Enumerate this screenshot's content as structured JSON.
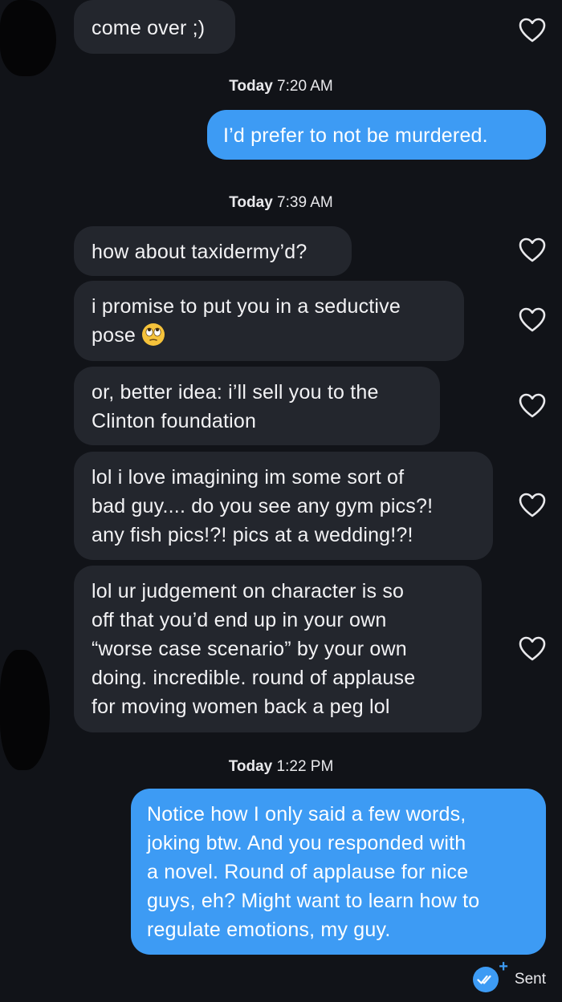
{
  "messages": [
    {
      "text": "come over ;)"
    },
    {
      "time_day": "Today",
      "time": "7:20 AM"
    },
    {
      "text": "I’d prefer to not be murdered."
    },
    {
      "time_day": "Today",
      "time": "7:39 AM"
    },
    {
      "text": "how about taxidermy’d?"
    },
    {
      "text_line1": "i promise to put you in a seductive",
      "text_line2": "pose"
    },
    {
      "text_line1": "or, better idea: i’ll sell you to the",
      "text_line2": "Clinton foundation"
    },
    {
      "text_line1": "lol i love imagining im some sort of",
      "text_line2": "bad guy.... do you see any gym pics?!",
      "text_line3": "any fish pics!?! pics at a wedding!?!"
    },
    {
      "text_line1": "lol ur judgement on character is so",
      "text_line2": "off that you’d end up in your own",
      "text_line3": "“worse case scenario” by your own",
      "text_line4": "doing. incredible. round of applause",
      "text_line5": "for moving women back a peg lol"
    },
    {
      "time_day": "Today",
      "time": "1:22 PM"
    },
    {
      "text_line1": "Notice how I only said a few words,",
      "text_line2": "joking btw. And you responded with",
      "text_line3": "a novel. Round of applause for nice",
      "text_line4": "guys, eh? Might want to learn how to",
      "text_line5": "regulate emotions, my guy."
    }
  ],
  "status": {
    "label": "Sent"
  },
  "icons": {
    "heart": "heart-outline-icon",
    "emoji": "eye-roll-emoji-icon",
    "read": "double-check-icon",
    "plus": "plus-icon"
  },
  "colors": {
    "background": "#111318",
    "incoming": "#23262d",
    "outgoing": "#3d9bf4"
  }
}
